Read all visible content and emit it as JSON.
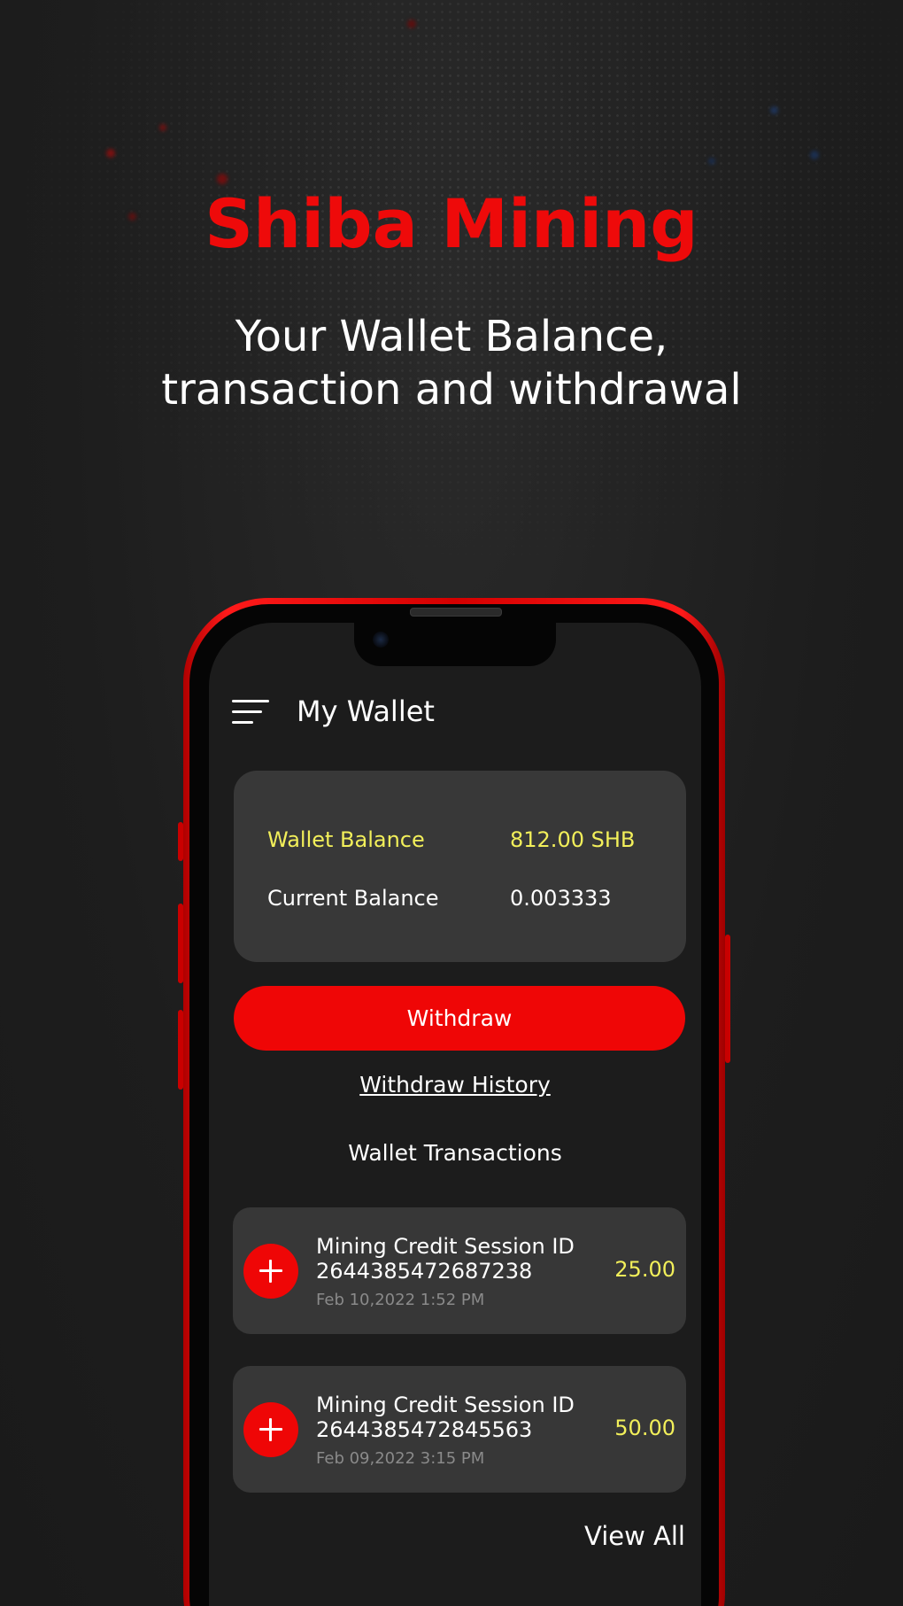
{
  "promo": {
    "headline": "Shiba Mining",
    "subline_1": "Your Wallet Balance,",
    "subline_2": "transaction and withdrawal"
  },
  "colors": {
    "accent": "#ef0606",
    "highlight": "#f2ef5a",
    "background": "#1c1c1c",
    "card": "#383838"
  },
  "app": {
    "menu_icon": "hamburger-menu-icon",
    "title": "My Wallet"
  },
  "balance": {
    "wallet_label": "Wallet Balance",
    "wallet_value": "812.00 SHB",
    "current_label": "Current Balance",
    "current_value": "0.003333"
  },
  "actions": {
    "withdraw_label": "Withdraw",
    "history_label": "Withdraw History"
  },
  "transactions": {
    "section_title": "Wallet Transactions",
    "items": [
      {
        "icon": "plus-icon",
        "title_line1": "Mining Credit Session ID",
        "title_line2": "2644385472687238",
        "date": "Feb 10,2022 1:52 PM",
        "amount": "25.00"
      },
      {
        "icon": "plus-icon",
        "title_line1": "Mining Credit Session ID",
        "title_line2": "2644385472845563",
        "date": "Feb 09,2022 3:15 PM",
        "amount": "50.00"
      }
    ],
    "view_all_label": "View All"
  }
}
